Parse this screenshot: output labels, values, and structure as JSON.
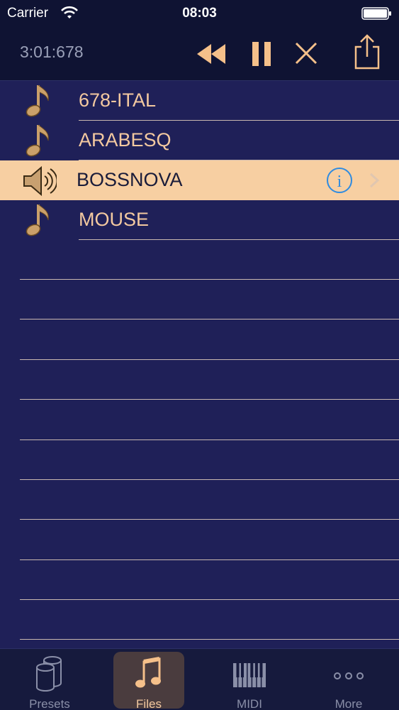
{
  "status_bar": {
    "carrier": "Carrier",
    "time": "08:03"
  },
  "toolbar": {
    "elapsed": "3:01:678",
    "icons": [
      "rewind-icon",
      "pause-icon",
      "close-icon",
      "share-icon"
    ],
    "accent_color": "#f5c08a"
  },
  "files": [
    {
      "name": "678-ITAL",
      "icon": "music-note-icon",
      "playing": false
    },
    {
      "name": "ARABESQ",
      "icon": "music-note-icon",
      "playing": false
    },
    {
      "name": "BOSSNOVA",
      "icon": "speaker-icon",
      "playing": true
    },
    {
      "name": "MOUSE",
      "icon": "music-note-icon",
      "playing": false
    }
  ],
  "tabs": [
    {
      "label": "Presets",
      "icon": "presets-icon",
      "active": false
    },
    {
      "label": "Files",
      "icon": "music-note-icon",
      "active": true
    },
    {
      "label": "MIDI",
      "icon": "piano-keys-icon",
      "active": false
    },
    {
      "label": "More",
      "icon": "more-dots-icon",
      "active": false
    }
  ],
  "colors": {
    "background": "#1f2058",
    "bar_background": "#0f1333",
    "selected_row": "#f7cfa2",
    "label_text": "#f3c9a0",
    "info_blue": "#2f8be0"
  }
}
